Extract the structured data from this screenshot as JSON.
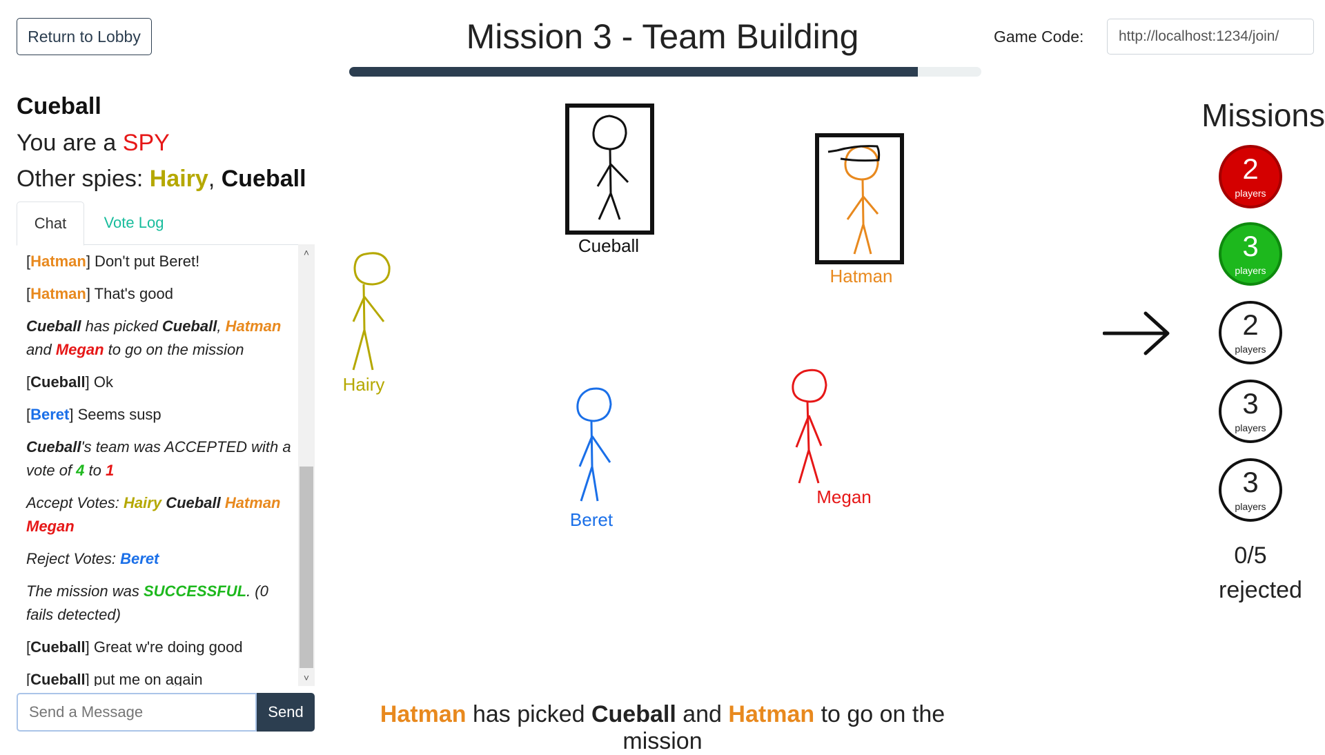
{
  "header": {
    "return_label": "Return to Lobby",
    "title": "Mission 3 - Team Building",
    "progress_fraction": 0.9,
    "game_code_label": "Game Code:",
    "game_code_value": "http://localhost:1234/join/"
  },
  "player": {
    "name": "Cueball",
    "role_prefix": "You are a ",
    "role": "SPY",
    "spies_prefix": "Other spies: ",
    "spy_1": "Hairy",
    "spy_sep": ", ",
    "spy_2": "Cueball"
  },
  "tabs": {
    "chat": "Chat",
    "vote_log": "Vote Log"
  },
  "chat": {
    "m1_name": "Hatman",
    "m1_text": " Don't put Beret!",
    "m2_name": "Hatman",
    "m2_text": " That's good",
    "m3_a": "Cueball",
    "m3_b": " has picked ",
    "m3_c": "Cueball",
    "m3_d": ", ",
    "m3_e": "Hatman",
    "m3_f": " and ",
    "m3_g": "Megan",
    "m3_h": " to go on the mission",
    "m4_name": "Cueball",
    "m4_text": " Ok",
    "m5_name": "Beret",
    "m5_text": " Seems susp",
    "m6_a": "Cueball",
    "m6_b": "'s team was ACCEPTED with a vote of ",
    "m6_c": "4",
    "m6_d": " to ",
    "m6_e": "1",
    "m7_a": "Accept Votes: ",
    "m7_b": "Hairy",
    "m7_c": "Cueball",
    "m7_d": "Hatman",
    "m7_e": "Megan",
    "m8_a": "Reject Votes: ",
    "m8_b": "Beret",
    "m9_a": "The mission was ",
    "m9_b": "SUCCESSFUL",
    "m9_c": ". (0 fails detected)",
    "m10_name": "Cueball",
    "m10_text": " Great w're doing good",
    "m11_name": "Cueball",
    "m11_text": " put me on again",
    "input_placeholder": "Send a Message",
    "send_label": "Send"
  },
  "board": {
    "cueball": "Cueball",
    "hatman": "Hatman",
    "hairy": "Hairy",
    "beret": "Beret",
    "megan": "Megan"
  },
  "status": {
    "a": "Hatman",
    "b": " has picked ",
    "c": "Cueball",
    "d": " and ",
    "e": "Hatman",
    "f": " to go on the mission"
  },
  "missions": {
    "title": "Missions",
    "items": [
      {
        "count": "2",
        "label": "players",
        "state": "failed"
      },
      {
        "count": "3",
        "label": "players",
        "state": "success"
      },
      {
        "count": "2",
        "label": "players",
        "state": "current"
      },
      {
        "count": "3",
        "label": "players",
        "state": "pending"
      },
      {
        "count": "3",
        "label": "players",
        "state": "pending"
      }
    ],
    "rejected_count": "0/5",
    "rejected_label": "rejected"
  },
  "colors": {
    "hairy": "#b5a800",
    "cueball": "#111111",
    "hatman": "#e8891e",
    "megan": "#e61717",
    "beret": "#1a6fe8",
    "accent": "#2c3e50",
    "link": "#18bc9c"
  }
}
